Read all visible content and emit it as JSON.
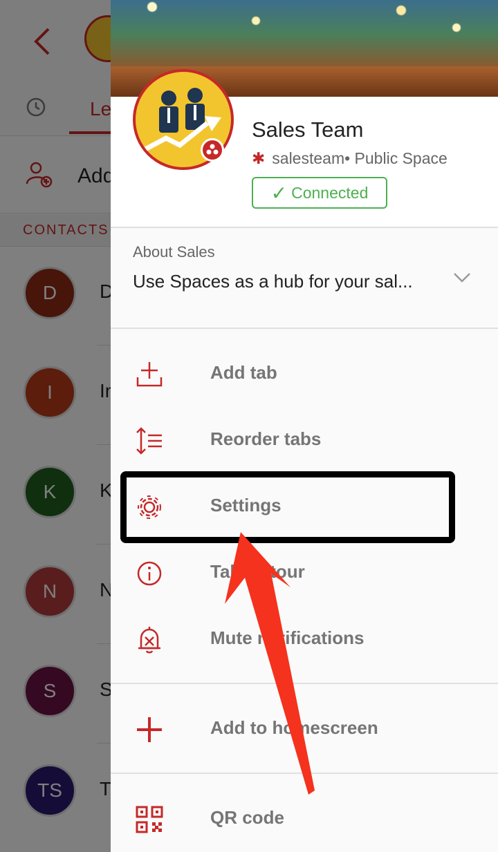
{
  "background": {
    "tab_partial": "Le",
    "add_partial": "Add",
    "contacts_header": "CONTACTS",
    "contacts": [
      {
        "initials": "D",
        "name_partial": "D",
        "color": "#8e2a14"
      },
      {
        "initials": "I",
        "name_partial": "In",
        "color": "#b83a18"
      },
      {
        "initials": "K",
        "name_partial": "K",
        "color": "#1f5e1f"
      },
      {
        "initials": "N",
        "name_partial": "N",
        "color": "#b23a3a"
      },
      {
        "initials": "S",
        "name_partial": "S",
        "color": "#6a1245"
      },
      {
        "initials": "TS",
        "name_partial": "T",
        "color": "#2b1a6e"
      }
    ]
  },
  "space": {
    "title": "Sales Team",
    "handle": "salesteam• Public Space",
    "status": "Connected",
    "about_label": "About Sales",
    "about_text": "Use Spaces as a hub for your sal..."
  },
  "menu": [
    {
      "label": "Add tab",
      "icon": "add-tab-icon"
    },
    {
      "label": "Reorder tabs",
      "icon": "reorder-icon"
    },
    {
      "label": "Settings",
      "icon": "gear-icon"
    },
    {
      "label": "Take a tour",
      "icon": "info-icon"
    },
    {
      "label": "Mute notifications",
      "icon": "mute-bell-icon"
    },
    {
      "label": "Add to homescreen",
      "icon": "plus-icon"
    },
    {
      "label": "QR code",
      "icon": "qr-code-icon"
    }
  ],
  "colors": {
    "accent": "#c62828",
    "connected": "#4caf50",
    "annotation_arrow": "#f4321e"
  }
}
